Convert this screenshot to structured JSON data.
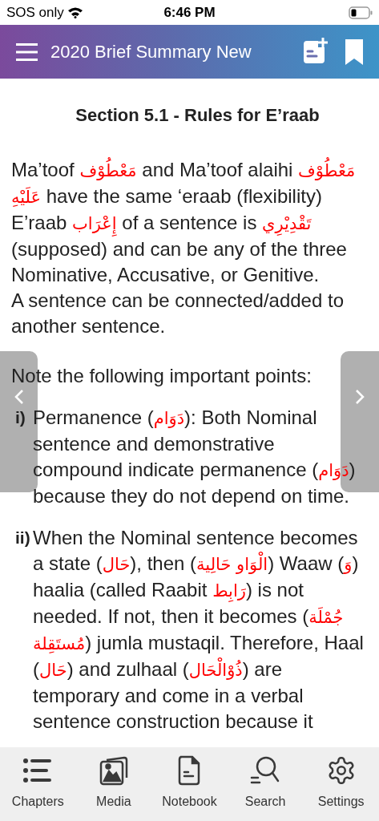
{
  "status_bar": {
    "carrier": "SOS only",
    "time": "6:46 PM"
  },
  "header": {
    "title": "2020 Brief Summary New"
  },
  "section_title": "Section 5.1 - Rules for E’raab",
  "paragraphs": [
    [
      {
        "kind": "latin",
        "text": "Ma’toof "
      },
      {
        "kind": "arabic",
        "text": "مَعْطُوْف"
      },
      {
        "kind": "latin",
        "text": " and Ma’toof alaihi "
      },
      {
        "kind": "arabic",
        "text": "مَعْطُوْف عَلَيْهِ"
      },
      {
        "kind": "latin",
        "text": " have the same ‘eraab (flexibility)"
      }
    ],
    [
      {
        "kind": "latin",
        "text": "E’raab "
      },
      {
        "kind": "arabic",
        "text": "إِعْرَاب"
      },
      {
        "kind": "latin",
        "text": " of a sentence is "
      },
      {
        "kind": "arabic",
        "text": "تَقْدِيْرِي"
      },
      {
        "kind": "latin",
        "text": " (supposed) and can be any of the three Nominative, Accusative, or Genitive."
      }
    ],
    [
      {
        "kind": "latin",
        "text": "A sentence can be connected/added to another sentence."
      }
    ]
  ],
  "note": "Note the following important points:",
  "points": [
    {
      "marker": "i)",
      "segments": [
        {
          "kind": "latin",
          "text": "Permanence ("
        },
        {
          "kind": "arabic",
          "text": "دَوَام"
        },
        {
          "kind": "latin",
          "text": "): Both Nominal sentence and demonstrative compound indicate permanence ("
        },
        {
          "kind": "arabic",
          "text": "دَوَام"
        },
        {
          "kind": "latin",
          "text": ") because they do not depend on time."
        }
      ]
    },
    {
      "marker": "ii)",
      "segments": [
        {
          "kind": "latin",
          "text": "When the Nominal sentence becomes a state ("
        },
        {
          "kind": "arabic",
          "text": "حَال"
        },
        {
          "kind": "latin",
          "text": "), then ("
        },
        {
          "kind": "arabic",
          "text": "الْوَاو حَالِية"
        },
        {
          "kind": "latin",
          "text": ") Waaw ("
        },
        {
          "kind": "arabic",
          "text": "وَ"
        },
        {
          "kind": "latin",
          "text": ") haalia (called Raabit "
        },
        {
          "kind": "arabic",
          "text": "رَابِط"
        },
        {
          "kind": "latin",
          "text": ") is not needed. If not, then it becomes ("
        },
        {
          "kind": "arabic",
          "text": "جُمْلَة مُستَقِلة"
        },
        {
          "kind": "latin",
          "text": ") jumla mustaqil. Therefore, Haal ("
        },
        {
          "kind": "arabic",
          "text": "حَال"
        },
        {
          "kind": "latin",
          "text": ") and zulhaal ("
        },
        {
          "kind": "arabic",
          "text": "ذُوْالْحَال"
        },
        {
          "kind": "latin",
          "text": ") are temporary and come in a verbal sentence construction because it"
        }
      ]
    }
  ],
  "tabs": [
    {
      "label": "Chapters",
      "kind": "list"
    },
    {
      "label": "Media",
      "kind": "media"
    },
    {
      "label": "Notebook",
      "kind": "notebook"
    },
    {
      "label": "Search",
      "kind": "search"
    },
    {
      "label": "Settings",
      "kind": "settings"
    }
  ]
}
